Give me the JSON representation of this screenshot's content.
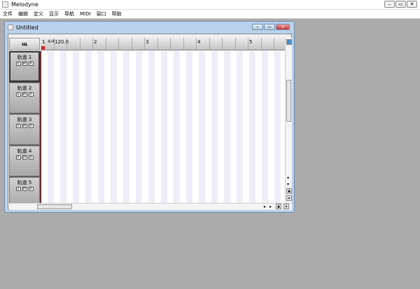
{
  "app": {
    "title": "Melodyne",
    "controls": [
      "‒",
      "▭",
      "✕"
    ]
  },
  "menu": [
    "文件",
    "编辑",
    "定义",
    "显示",
    "导航",
    "MIDI",
    "窗口",
    "帮助"
  ],
  "document": {
    "title": "Untitled",
    "controls": [
      "‒",
      "▭",
      "✕"
    ]
  },
  "corner_label": "щ",
  "ruler": {
    "bars": [
      "1",
      "2",
      "3",
      "4",
      "5"
    ],
    "time_signature": "4/4",
    "tempo": "120.0"
  },
  "tracks": [
    {
      "name": "轨道 1",
      "buttons": [
        "S",
        "M",
        "R"
      ]
    },
    {
      "name": "轨道 2",
      "buttons": [
        "S",
        "M",
        "R"
      ]
    },
    {
      "name": "轨道 3",
      "buttons": [
        "S",
        "M",
        "R"
      ]
    },
    {
      "name": "轨道 4",
      "buttons": [
        "S",
        "M",
        "R"
      ]
    },
    {
      "name": "轨道 5",
      "buttons": [
        "S",
        "M",
        "R"
      ]
    }
  ]
}
